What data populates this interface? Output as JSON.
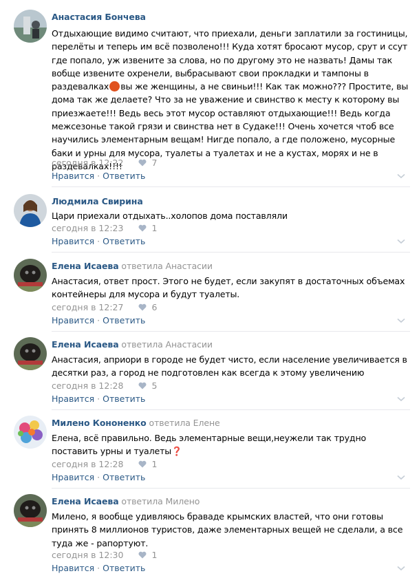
{
  "comments": [
    {
      "author": "Анастасия Бончева",
      "reply_label": "",
      "reply_to": "",
      "text_before_emoji": "Отдыхающие видимо считают, что приехали, деньги заплатили за гостиницы, перелёты и теперь им всё позволено!!! Куда хотят бросают мусор, срут и ссут где попало, уж извените за слова, но по другому это не назвать! Дамы так вобще извените охренели, выбрасывают свои прокладки и тампоны в раздевалках",
      "text_after_emoji": "вы же женщины, а не свиньи!!! Как так можно??? Простите, вы дома так же делаете? Что за не уважение и свинство к месту к которому вы приезжаете!!! Ведь весь этот мусор оставляют отдыхающие!!! Ведь когда межсезонье такой грязи и свинства нет в Судаке!!! Очень хочется чтоб все научились элементарным вещам! Нигде попало, а где положено, мусорные баки и урны для мусора, туалеты а туалетах и не а кустах, морях и не в раздевалках!!!!",
      "emoji_icon": "angry-face-icon",
      "time": "сегодня в 12:22",
      "likes": "7"
    },
    {
      "author": "Людмила Свирина",
      "reply_label": "",
      "reply_to": "",
      "text": "Цари приехали отдыхать..холопов дома поставляли",
      "time": "сегодня в 12:23",
      "likes": "1"
    },
    {
      "author": "Елена Исаева",
      "reply_label": "ответила",
      "reply_to": "Анастасии",
      "text": "Анастасия, ответ прост. Этого не будет, если закупят в достаточных объемах контейнеры для мусора и будут туалеты.",
      "time": "сегодня в 12:27",
      "likes": "6"
    },
    {
      "author": "Елена Исаева",
      "reply_label": "ответила",
      "reply_to": "Анастасии",
      "text": "Анастасия, априори в городе не будет чисто, если население увеличивается в десятки раз, а город не подготовлен как всегда к этому увеличению",
      "time": "сегодня в 12:28",
      "likes": "5"
    },
    {
      "author": "Милено Кононенко",
      "reply_label": "ответила",
      "reply_to": "Елене",
      "text": "Елена, всё правильно. Ведь элементарные вещи,неужели так трудно поставить урны и туалеты❓",
      "time": "сегодня в 12:28",
      "likes": "1"
    },
    {
      "author": "Елена Исаева",
      "reply_label": "ответила",
      "reply_to": "Милено",
      "text": "Милено, я вообще удивляюсь браваде крымских властей, что они готовы принять 8 миллионов туристов, даже элементарных вещей не сделали, а все туда же - рапортуют.",
      "time": "сегодня в 12:30",
      "likes": "1"
    }
  ],
  "actions": {
    "like_label": "Нравится",
    "reply_label": "Ответить",
    "separator": "·"
  },
  "icons": {
    "like": "heart-icon",
    "more": "chevron-down-icon"
  },
  "colors": {
    "link": "#2a5885",
    "muted": "#939393",
    "divider": "#e7e8ec"
  }
}
